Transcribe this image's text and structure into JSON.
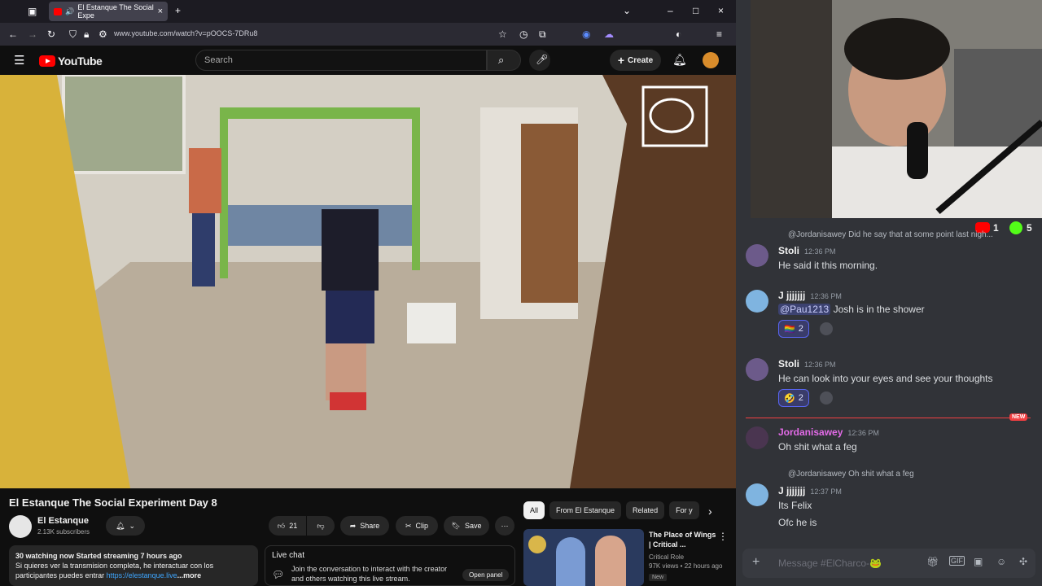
{
  "browser": {
    "tab_title": "El Estanque The Social Expe",
    "url": "www.youtube.com/watch?v=pOOCS-7DRu8"
  },
  "youtube": {
    "logo_text": "YouTube",
    "search_placeholder": "Search",
    "create_label": "Create",
    "video_title": "El Estanque The Social Experiment Day 8",
    "channel_name": "El Estanque",
    "channel_subs": "2.13K subscribers",
    "likes": "21",
    "share_label": "Share",
    "clip_label": "Clip",
    "save_label": "Save",
    "desc_line1": "30 watching now  Started streaming 7 hours ago",
    "desc_line2": "Si quieres ver la transmision completa, he interactuar con los",
    "desc_line3_pre": "participantes puedes entrar ",
    "desc_link": "https://elestanque.live",
    "desc_more": "...more",
    "live_chat_title": "Live chat",
    "live_chat_text": "Join the conversation to interact with the creator and others watching this live stream.",
    "open_panel_label": "Open panel",
    "chips": [
      "All",
      "From El Estanque",
      "Related",
      "For y"
    ],
    "reco": {
      "title": "The Place of Wings | Critical ...",
      "channel": "Critical Role",
      "meta": "97K views • 22 hours ago",
      "badge": "New"
    }
  },
  "stream_overlay": {
    "yt_count": "1",
    "other_count": "5"
  },
  "discord": {
    "messages": [
      {
        "reply_to": "@Jordanisawey Did he say that at some point last nigh...",
        "name": "Stoli",
        "time": "12:36 PM",
        "text": "He said it this morning.",
        "color": "#f2f3f5"
      },
      {
        "name": "J jjjjjjj",
        "time": "12:36 PM",
        "mention": "@Pau1213",
        "text": " Josh is in the shower",
        "reaction": "2",
        "color": "#f2f3f5"
      },
      {
        "name": "Stoli",
        "time": "12:36 PM",
        "text": "He can look into your eyes and see your thoughts",
        "reaction": "2",
        "color": "#f2f3f5"
      },
      {
        "name": "Jordanisawey",
        "time": "12:36 PM",
        "text": "Oh shit what a feg",
        "color": "#e36be8"
      },
      {
        "reply_to": "@Jordanisawey Oh shit what a feg",
        "name": "J jjjjjjj",
        "time": "12:37 PM",
        "text": "Its Felix",
        "text2": "Ofc he is",
        "color": "#f2f3f5"
      }
    ],
    "new_tag": "NEW",
    "composer_placeholder": "Message #ElCharco-🐸"
  }
}
